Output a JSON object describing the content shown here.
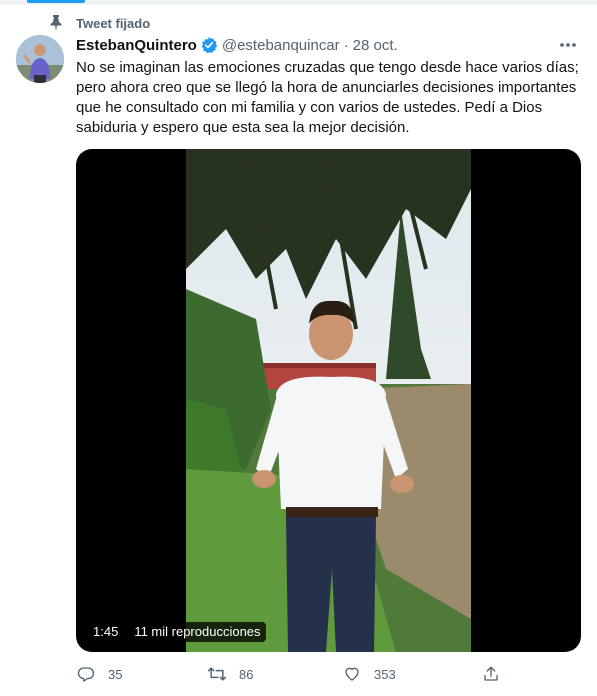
{
  "pinned": {
    "label": "Tweet fijado",
    "icon": "pin-icon"
  },
  "author": {
    "name": "EstebanQuintero",
    "verified_icon": "verified-badge-icon",
    "handle": "@estebanquincar",
    "separator": "·",
    "date": "28 oct."
  },
  "more_icon": "more-options-icon",
  "tweet": {
    "text": "No se imaginan las emociones cruzadas que tengo desde hace varios días;\npero ahora creo que se llegó la hora de anunciarles decisiones importantes\nque he consultado con mi familia y con varios de ustedes. Pedí a Dios\nsabiduria y espero que esta sea la mejor decisión."
  },
  "video": {
    "duration": "1:45",
    "views": "11 mil reproducciones"
  },
  "actions": {
    "replies": "35",
    "retweets": "86",
    "likes": "353"
  },
  "colors": {
    "accent": "#1d9bf0",
    "text": "#0f1419",
    "secondary": "#536471"
  }
}
